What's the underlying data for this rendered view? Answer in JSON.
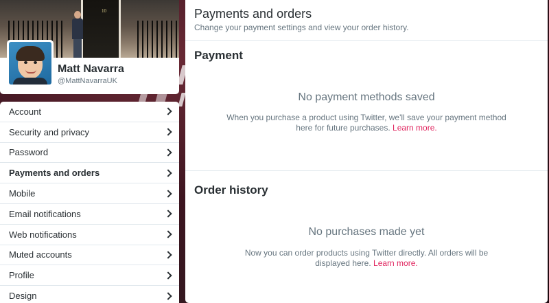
{
  "profile": {
    "name": "Matt Navarra",
    "handle": "@MattNavarraUK",
    "banner_door_number": "10"
  },
  "nav": {
    "items": [
      {
        "label": "Account",
        "active": false
      },
      {
        "label": "Security and privacy",
        "active": false
      },
      {
        "label": "Password",
        "active": false
      },
      {
        "label": "Payments and orders",
        "active": true
      },
      {
        "label": "Mobile",
        "active": false
      },
      {
        "label": "Email notifications",
        "active": false
      },
      {
        "label": "Web notifications",
        "active": false
      },
      {
        "label": "Muted accounts",
        "active": false
      },
      {
        "label": "Profile",
        "active": false
      },
      {
        "label": "Design",
        "active": false
      }
    ]
  },
  "main": {
    "title": "Payments and orders",
    "subtitle": "Change your payment settings and view your order history.",
    "payment": {
      "heading": "Payment",
      "empty_title": "No payment methods saved",
      "empty_desc": "When you purchase a product using Twitter, we'll save your payment method here for future purchases.",
      "learn_more": "Learn more."
    },
    "orders": {
      "heading": "Order history",
      "empty_title": "No purchases made yet",
      "empty_desc": "Now you can order products using Twitter directly. All orders will be displayed here.",
      "learn_more": "Learn more."
    }
  },
  "colors": {
    "link": "#e0245e",
    "text": "#292f33",
    "muted": "#66757f",
    "divider": "#e1e8ed"
  }
}
